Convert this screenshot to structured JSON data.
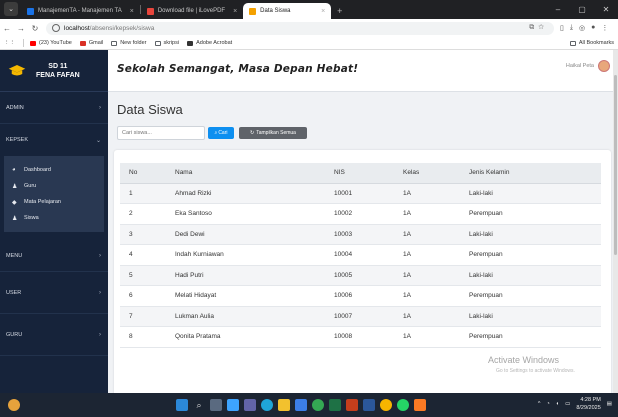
{
  "browser": {
    "tabs": [
      {
        "label": "ManajemenTA - Manajemen TA",
        "active": false,
        "color": "#1a73e8"
      },
      {
        "label": "Download file | iLovePDF",
        "active": false,
        "color": "#e8453c"
      },
      {
        "label": "Data Siswa",
        "active": true,
        "color": "#f4a100"
      }
    ],
    "url_host": "localhost",
    "url_path": "/absensi/kepsek/siswa",
    "bookmarks": [
      {
        "label": "(23) YouTube",
        "color": "#ff0000"
      },
      {
        "label": "Gmail",
        "color": "#d93025"
      },
      {
        "label": "New folder",
        "color": "#5f6368"
      },
      {
        "label": "skripsi",
        "color": "#5f6368"
      },
      {
        "label": "Adobe Acrobat",
        "color": "#333333"
      }
    ],
    "all_bookmarks": "All Bookmarks"
  },
  "sidebar": {
    "brand_line1": "SD 11",
    "brand_line2": "FENA FAFAN",
    "menus": [
      {
        "label": "ADMIN"
      },
      {
        "label": "KEPSEK"
      },
      {
        "label": "MENU"
      },
      {
        "label": "USER"
      },
      {
        "label": "GURU"
      }
    ],
    "kepsek_items": [
      {
        "label": "Dashboard",
        "icon": "palette-icon"
      },
      {
        "label": "Guru",
        "icon": "users-icon"
      },
      {
        "label": "Mata Pelajaran",
        "icon": "graduation-icon"
      },
      {
        "label": "Siswa",
        "icon": "users-icon"
      }
    ]
  },
  "header": {
    "motto": "Sekolah Semangat, Masa Depan Hebat!",
    "user_name": "Haikal Peta"
  },
  "main": {
    "title": "Data Siswa",
    "search_placeholder": "Cari siswa...",
    "search_button": "Cari",
    "show_all_button": "Tampilkan Semua",
    "columns": [
      "No",
      "Nama",
      "NIS",
      "Kelas",
      "Jenis Kelamin"
    ],
    "rows": [
      [
        "1",
        "Ahmad Rizki",
        "10001",
        "1A",
        "Laki-laki"
      ],
      [
        "2",
        "Eka Santoso",
        "10002",
        "1A",
        "Perempuan"
      ],
      [
        "3",
        "Dedi Dewi",
        "10003",
        "1A",
        "Laki-laki"
      ],
      [
        "4",
        "Indah Kurniawan",
        "10004",
        "1A",
        "Perempuan"
      ],
      [
        "5",
        "Hadi Putri",
        "10005",
        "1A",
        "Laki-laki"
      ],
      [
        "6",
        "Melati Hidayat",
        "10006",
        "1A",
        "Perempuan"
      ],
      [
        "7",
        "Lukman Aulia",
        "10007",
        "1A",
        "Laki-laki"
      ],
      [
        "8",
        "Qonita Pratama",
        "10008",
        "1A",
        "Perempuan"
      ]
    ]
  },
  "watermark": {
    "title": "Activate Windows",
    "subtitle": "Go to Settings to activate Windows."
  },
  "taskbar": {
    "time": "4:28 PM",
    "date": "8/29/2025"
  }
}
